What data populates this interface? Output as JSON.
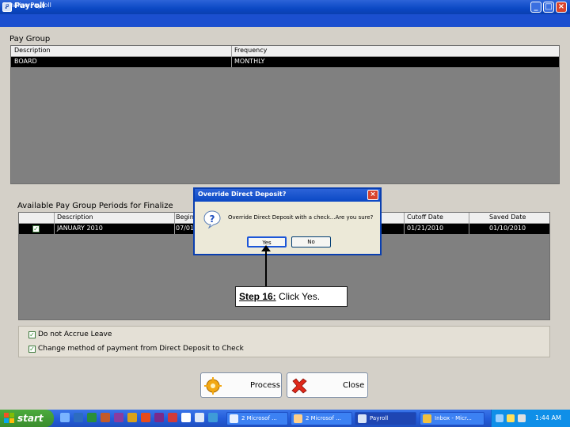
{
  "window": {
    "title": "Payroll",
    "menu_title": "Finalize Payroll",
    "icon_letter": "P"
  },
  "pay_group": {
    "label": "Pay Group",
    "columns": [
      "Description",
      "Frequency"
    ],
    "row": [
      "BOARD",
      "MONTHLY"
    ]
  },
  "periods": {
    "label": "Available Pay Group Periods for Finalize",
    "columns": [
      "Description",
      "Begin",
      "Cutoff Date",
      "Saved Date"
    ],
    "row": {
      "checked": true,
      "description": "JANUARY 2010",
      "begin": "07/01",
      "cutoff": "01/21/2010",
      "saved": "01/10/2010"
    }
  },
  "options": [
    {
      "label": "Do not Accrue Leave",
      "checked": true
    },
    {
      "label": "Change method of payment from Direct Deposit to Check",
      "checked": true
    }
  ],
  "buttons": {
    "process": "Process",
    "close": "Close"
  },
  "dialog": {
    "title": "Override Direct Deposit?",
    "message": "Override Direct Deposit with a check...Are you sure?",
    "yes": "Yes",
    "no": "No"
  },
  "callout": {
    "step": "Step 16:",
    "text": "Click Yes."
  },
  "taskbar": {
    "start": "start",
    "tasks": [
      "2 Microsof ...",
      "2 Microsof ...",
      "Payroll",
      "Inbox - Micr..."
    ],
    "time": "1:44 AM"
  },
  "colors": {
    "titlebar": "#0b48c4",
    "grid_bg": "#808080",
    "selected_row": "#000000",
    "taskbar": "#245edb",
    "start": "#3a8d2d"
  }
}
